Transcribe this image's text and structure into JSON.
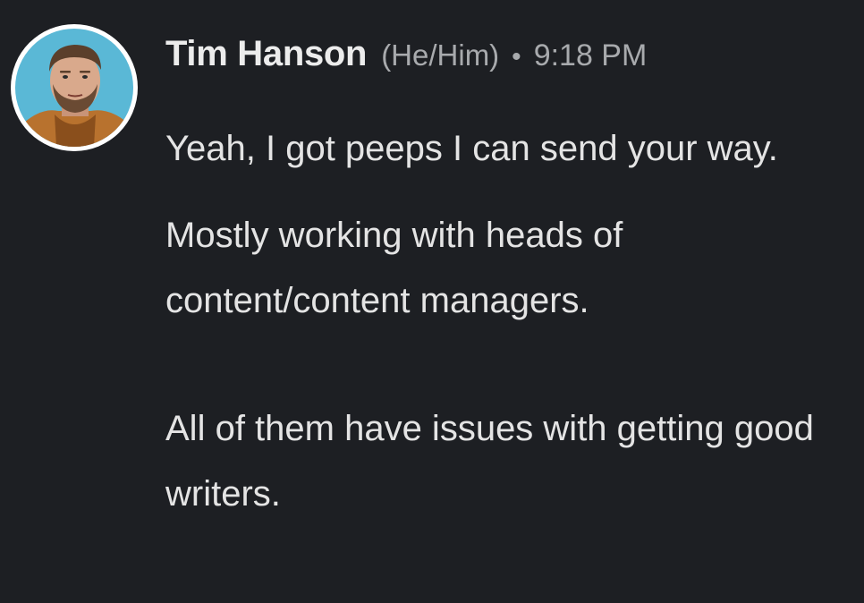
{
  "author": {
    "name": "Tim Hanson",
    "pronouns": "(He/Him)",
    "separator": "•",
    "timestamp": "9:18 PM",
    "avatar_icon": "user-photo-avatar"
  },
  "messages": [
    "Yeah, I got peeps I can send your way.",
    "Mostly working with heads of content/content managers.",
    "All of them have issues with getting good writers."
  ],
  "colors": {
    "background": "#1d1f23",
    "name": "#ececec",
    "meta": "#a8aaad",
    "text": "#e4e4e4",
    "avatar_bg": "#5ab8d6"
  }
}
